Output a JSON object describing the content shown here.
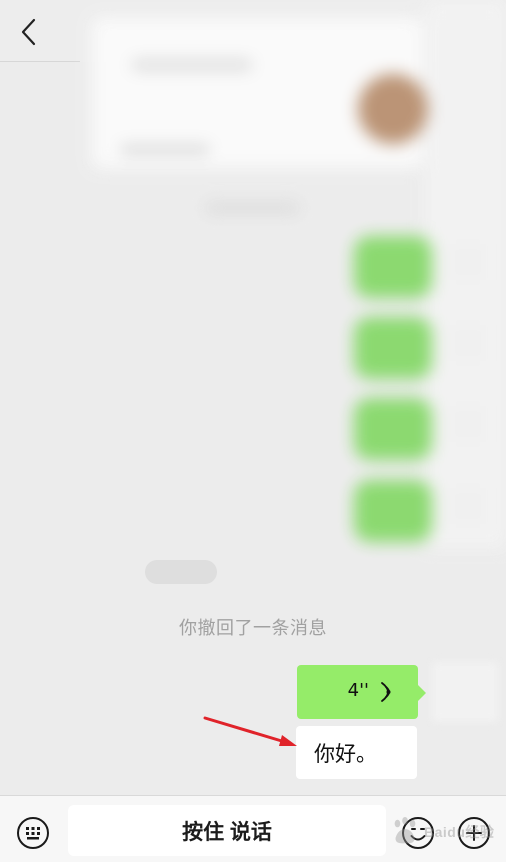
{
  "chat": {
    "system_notice": "你撤回了一条消息",
    "voice_duration": "4''",
    "transcript_text": "你好。"
  },
  "bottom_bar": {
    "hold_to_talk": "按住 说话"
  },
  "icons": {
    "back": "chevron-left-icon",
    "voice_wave": "voice-wave-icon",
    "keyboard": "keyboard-icon",
    "emoji": "emoji-icon",
    "plus": "plus-icon",
    "arrow": "annotation-arrow"
  },
  "colors": {
    "chat_bg": "#ececec",
    "sent_bubble": "#95ec69",
    "arrow_red": "#e0232a"
  },
  "watermark": {
    "brand_text": "Baidu经验"
  }
}
